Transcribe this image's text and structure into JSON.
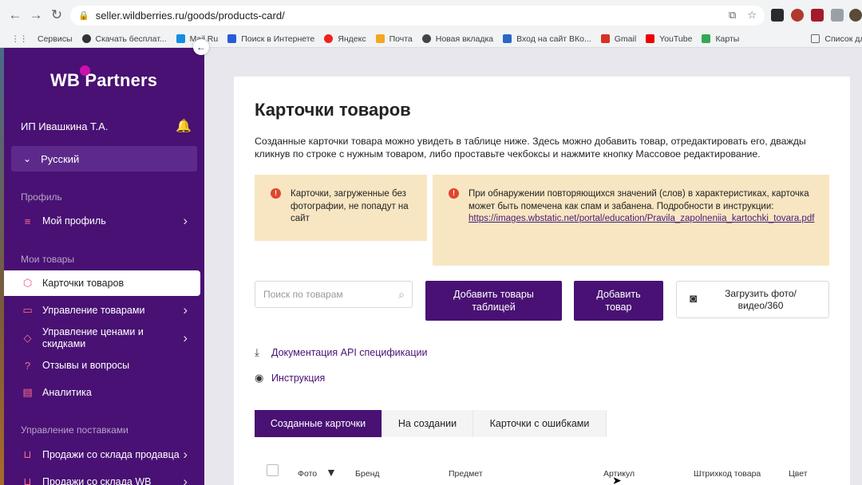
{
  "browser": {
    "url": "seller.wildberries.ru/goods/products-card/",
    "bookmarks": [
      "Сервисы",
      "Скачать бесплат...",
      "Mail.Ru",
      "Поиск в Интернете",
      "Яндекс",
      "Почта",
      "Новая вкладка",
      "Вход на сайт ВКо...",
      "Gmail",
      "YouTube",
      "Карты",
      "Список для чт"
    ]
  },
  "sidebar": {
    "logo": "WB Partners",
    "user": "ИП Ивашкина Т.А.",
    "language": "Русский",
    "section_profile": "Профиль",
    "my_profile": "Мой профиль",
    "section_goods": "Мои товары",
    "product_cards": "Карточки товаров",
    "goods_management": "Управление товарами",
    "price_management": "Управление ценами и скидками",
    "reviews": "Отзывы и вопросы",
    "analytics": "Аналитика",
    "section_supplies": "Управление поставками",
    "sales_seller_stock": "Продажи со склада продавца",
    "sales_wb_stock": "Продажи со склада WB"
  },
  "main": {
    "title": "Карточки товаров",
    "description": "Созданные карточки товара можно увидеть в таблице ниже. Здесь можно добавить товар, отредактировать его, дважды кликнув по строке с нужным товаром, либо проставьте чекбоксы и нажмите кнопку Массовое редактирование.",
    "warning_photo": "Карточки, загруженные без фотографии, не попадут на сайт",
    "warning_spam": "При обнаружении повторяющихся значений (слов) в характеристиках, карточка может быть помечена как спам и забанена. Подробности в инструкции:",
    "warning_link": "https://images.wbstatic.net/portal/education/Pravila_zapolneniia_kartochki_tovara.pdf",
    "search_placeholder": "Поиск по товарам",
    "btn_add_table": "Добавить товары таблицей",
    "btn_add_item": "Добавить товар",
    "btn_upload": "Загрузить фото/видео/360",
    "api_doc": "Документация API спецификации",
    "instruction": "Инструкция",
    "tabs": [
      "Созданные карточки",
      "На создании",
      "Карточки с ошибками"
    ],
    "columns": [
      "Фото",
      "Бренд",
      "Предмет",
      "Артикул",
      "Штрихкод товара",
      "Цвет"
    ]
  },
  "colors": {
    "brand": "#481173",
    "accent": "#cb11ab",
    "warning_bg": "#f8e6c2"
  }
}
